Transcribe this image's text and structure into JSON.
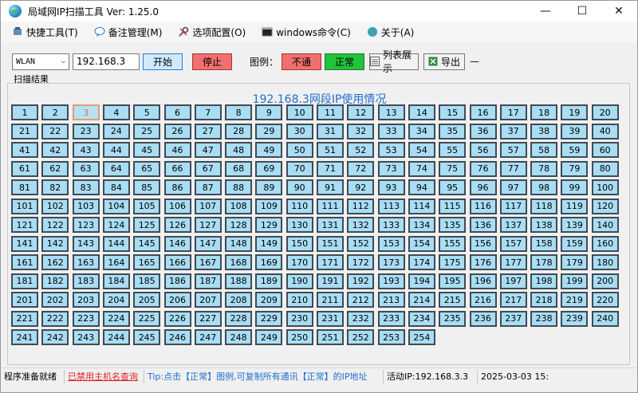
{
  "window": {
    "title": "局域网IP扫描工具  Ver: 1.25.0",
    "controls": {
      "minimize": "—",
      "maximize": "☐",
      "close": "✕"
    }
  },
  "menu": [
    {
      "label": "快捷工具(T)",
      "icon": "tools-icon"
    },
    {
      "label": "备注管理(M)",
      "icon": "chat-icon"
    },
    {
      "label": "选项配置(O)",
      "icon": "wrench-icon"
    },
    {
      "label": "windows命令(C)",
      "icon": "console-icon"
    },
    {
      "label": "关于(A)",
      "icon": "globe-icon"
    }
  ],
  "toolbar": {
    "interface_value": "WLAN",
    "ip_value": "192.168.3",
    "start_label": "开始",
    "stop_label": "停止",
    "legend_label": "图例：",
    "legend_bad": "不通",
    "legend_ok": "正常",
    "list_label": "列表展示",
    "export_label": "导出",
    "dash": "—"
  },
  "results_label": "扫描结果",
  "panel_title": "192.168.3网段IP使用情况",
  "grid": {
    "count": 254,
    "selected": 3,
    "colors": {
      "cell": "#a9ddf3",
      "border": "#3f4b55",
      "selected_text": "#e07030"
    }
  },
  "status": {
    "ready": "程序准备就绪",
    "disabled_link": "已禁用主机名查询",
    "tip": "Tip:点击【正常】图例,可复制所有通讯【正常】的IP地址",
    "active": "活动IP:192.168.3.3",
    "date": "2025-03-03 15:"
  }
}
